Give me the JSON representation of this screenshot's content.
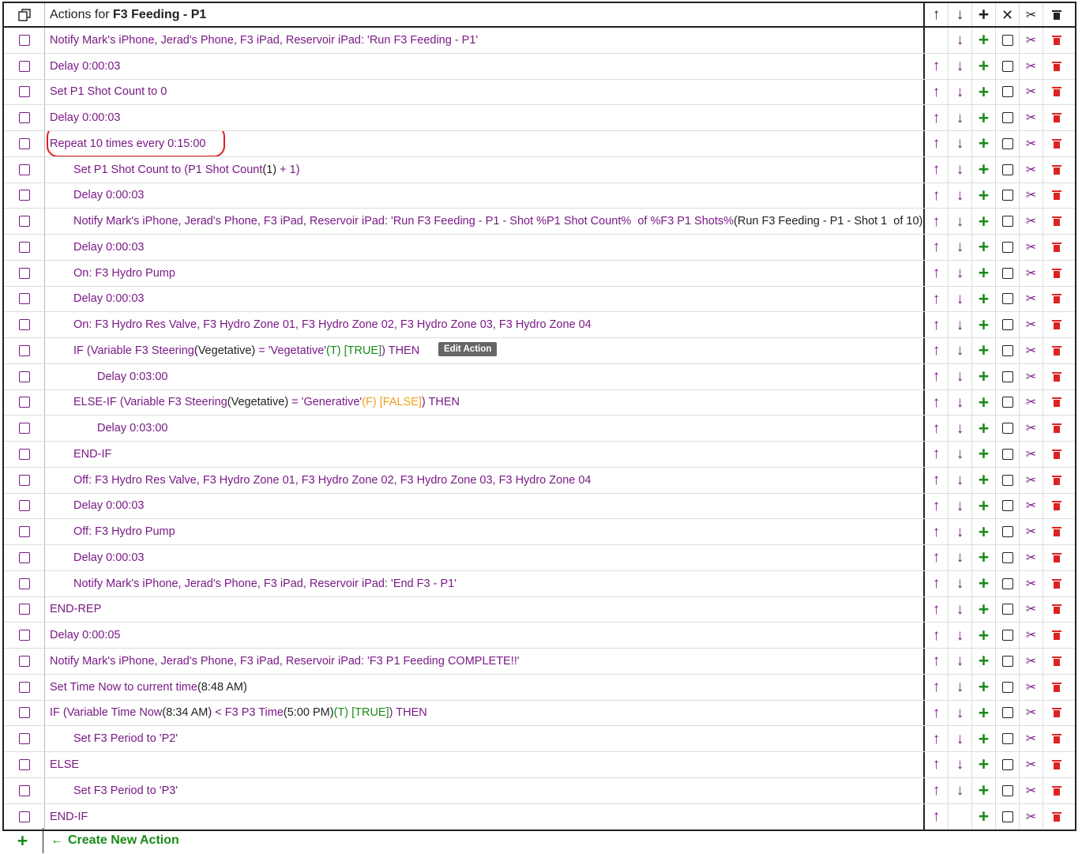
{
  "header": {
    "title_prefix": "Actions for ",
    "title_name": "F3 Feeding - P1"
  },
  "rows": [
    {
      "indent": 0,
      "parts": [
        {
          "t": "Notify Mark's iPhone, Jerad's Phone, F3 iPad, Reservoir iPad: 'Run F3 Feeding - P1'",
          "c": "p"
        }
      ],
      "up": false,
      "down": true
    },
    {
      "indent": 0,
      "parts": [
        {
          "t": "Delay 0:00:03",
          "c": "p"
        }
      ],
      "up": true,
      "down": true
    },
    {
      "indent": 0,
      "parts": [
        {
          "t": "Set P1 Shot Count to 0",
          "c": "p"
        }
      ],
      "up": true,
      "down": true
    },
    {
      "indent": 0,
      "parts": [
        {
          "t": "Delay 0:00:03",
          "c": "p"
        }
      ],
      "up": true,
      "down": true
    },
    {
      "indent": 0,
      "parts": [
        {
          "t": "Repeat 10 times every 0:15:00",
          "c": "p"
        }
      ],
      "up": true,
      "down": true,
      "highlight": true
    },
    {
      "indent": 1,
      "parts": [
        {
          "t": "Set P1 Shot Count to (P1 Shot Count",
          "c": "p"
        },
        {
          "t": "(1)",
          "c": "k"
        },
        {
          "t": " + 1)",
          "c": "p"
        }
      ],
      "up": true,
      "down": true
    },
    {
      "indent": 1,
      "parts": [
        {
          "t": "Delay 0:00:03",
          "c": "p"
        }
      ],
      "up": true,
      "down": true
    },
    {
      "indent": 1,
      "parts": [
        {
          "t": "Notify Mark's iPhone, Jerad's Phone, F3 iPad, Reservoir iPad: 'Run F3 Feeding - P1 - Shot %P1 Shot Count%  of %F3 P1 Shots%",
          "c": "p"
        },
        {
          "t": "(Run F3 Feeding - P1 - Shot 1  of 10)",
          "c": "k"
        },
        {
          "t": "'",
          "c": "p"
        }
      ],
      "up": true,
      "down": true
    },
    {
      "indent": 1,
      "parts": [
        {
          "t": "Delay 0:00:03",
          "c": "p"
        }
      ],
      "up": true,
      "down": true
    },
    {
      "indent": 1,
      "parts": [
        {
          "t": "On: F3 Hydro Pump",
          "c": "p"
        }
      ],
      "up": true,
      "down": true
    },
    {
      "indent": 1,
      "parts": [
        {
          "t": "Delay 0:00:03",
          "c": "p"
        }
      ],
      "up": true,
      "down": true
    },
    {
      "indent": 1,
      "parts": [
        {
          "t": "On: F3 Hydro Res Valve, F3 Hydro Zone 01, F3 Hydro Zone 02, F3 Hydro Zone 03, F3 Hydro Zone 04",
          "c": "p"
        }
      ],
      "up": true,
      "down": true
    },
    {
      "indent": 1,
      "parts": [
        {
          "t": "IF (Variable F3 Steering",
          "c": "p"
        },
        {
          "t": "(Vegetative)",
          "c": "k"
        },
        {
          "t": " = 'Vegetative'",
          "c": "p"
        },
        {
          "t": "(T) [TRUE]",
          "c": "g"
        },
        {
          "t": ") THEN",
          "c": "p"
        }
      ],
      "up": true,
      "down": true,
      "tooltip": "Edit Action"
    },
    {
      "indent": 2,
      "parts": [
        {
          "t": "Delay 0:03:00",
          "c": "p"
        }
      ],
      "up": true,
      "down": true
    },
    {
      "indent": 1,
      "parts": [
        {
          "t": "ELSE-IF (Variable F3 Steering",
          "c": "p"
        },
        {
          "t": "(Vegetative)",
          "c": "k"
        },
        {
          "t": " = 'Generative'",
          "c": "p"
        },
        {
          "t": "(F) [FALSE]",
          "c": "o"
        },
        {
          "t": ") THEN",
          "c": "p"
        }
      ],
      "up": true,
      "down": true
    },
    {
      "indent": 2,
      "parts": [
        {
          "t": "Delay 0:03:00",
          "c": "p"
        }
      ],
      "up": true,
      "down": true
    },
    {
      "indent": 1,
      "parts": [
        {
          "t": "END-IF",
          "c": "p"
        }
      ],
      "up": true,
      "down": true
    },
    {
      "indent": 1,
      "parts": [
        {
          "t": "Off: F3 Hydro Res Valve, F3 Hydro Zone 01, F3 Hydro Zone 02, F3 Hydro Zone 03, F3 Hydro Zone 04",
          "c": "p"
        }
      ],
      "up": true,
      "down": true
    },
    {
      "indent": 1,
      "parts": [
        {
          "t": "Delay 0:00:03",
          "c": "p"
        }
      ],
      "up": true,
      "down": true
    },
    {
      "indent": 1,
      "parts": [
        {
          "t": "Off: F3 Hydro Pump",
          "c": "p"
        }
      ],
      "up": true,
      "down": true
    },
    {
      "indent": 1,
      "parts": [
        {
          "t": "Delay 0:00:03",
          "c": "p"
        }
      ],
      "up": true,
      "down": true
    },
    {
      "indent": 1,
      "parts": [
        {
          "t": "Notify Mark's iPhone, Jerad's Phone, F3 iPad, Reservoir iPad: 'End F3 - P1'",
          "c": "p"
        }
      ],
      "up": true,
      "down": true
    },
    {
      "indent": 0,
      "parts": [
        {
          "t": "END-REP",
          "c": "p"
        }
      ],
      "up": true,
      "down": true
    },
    {
      "indent": 0,
      "parts": [
        {
          "t": "Delay 0:00:05",
          "c": "p"
        }
      ],
      "up": true,
      "down": true
    },
    {
      "indent": 0,
      "parts": [
        {
          "t": "Notify Mark's iPhone, Jerad's Phone, F3 iPad, Reservoir iPad: 'F3 P1 Feeding COMPLETE!!'",
          "c": "p"
        }
      ],
      "up": true,
      "down": true
    },
    {
      "indent": 0,
      "parts": [
        {
          "t": "Set Time Now to current time",
          "c": "p"
        },
        {
          "t": "(8:48 AM)",
          "c": "k"
        }
      ],
      "up": true,
      "down": true
    },
    {
      "indent": 0,
      "parts": [
        {
          "t": "IF (Variable Time Now",
          "c": "p"
        },
        {
          "t": "(8:34 AM)",
          "c": "k"
        },
        {
          "t": " < F3 P3 Time",
          "c": "p"
        },
        {
          "t": "(5:00 PM)",
          "c": "k"
        },
        {
          "t": "(T) [TRUE]",
          "c": "g"
        },
        {
          "t": ") THEN",
          "c": "p"
        }
      ],
      "up": true,
      "down": true
    },
    {
      "indent": 1,
      "parts": [
        {
          "t": "Set F3 Period to 'P2'",
          "c": "p"
        }
      ],
      "up": true,
      "down": true
    },
    {
      "indent": 0,
      "parts": [
        {
          "t": "ELSE",
          "c": "p"
        }
      ],
      "up": true,
      "down": true
    },
    {
      "indent": 1,
      "parts": [
        {
          "t": "Set F3 Period to 'P3'",
          "c": "p"
        }
      ],
      "up": true,
      "down": true
    },
    {
      "indent": 0,
      "parts": [
        {
          "t": "END-IF",
          "c": "p"
        }
      ],
      "up": true,
      "down": false
    }
  ],
  "footer": {
    "create_label": "Create New Action"
  }
}
